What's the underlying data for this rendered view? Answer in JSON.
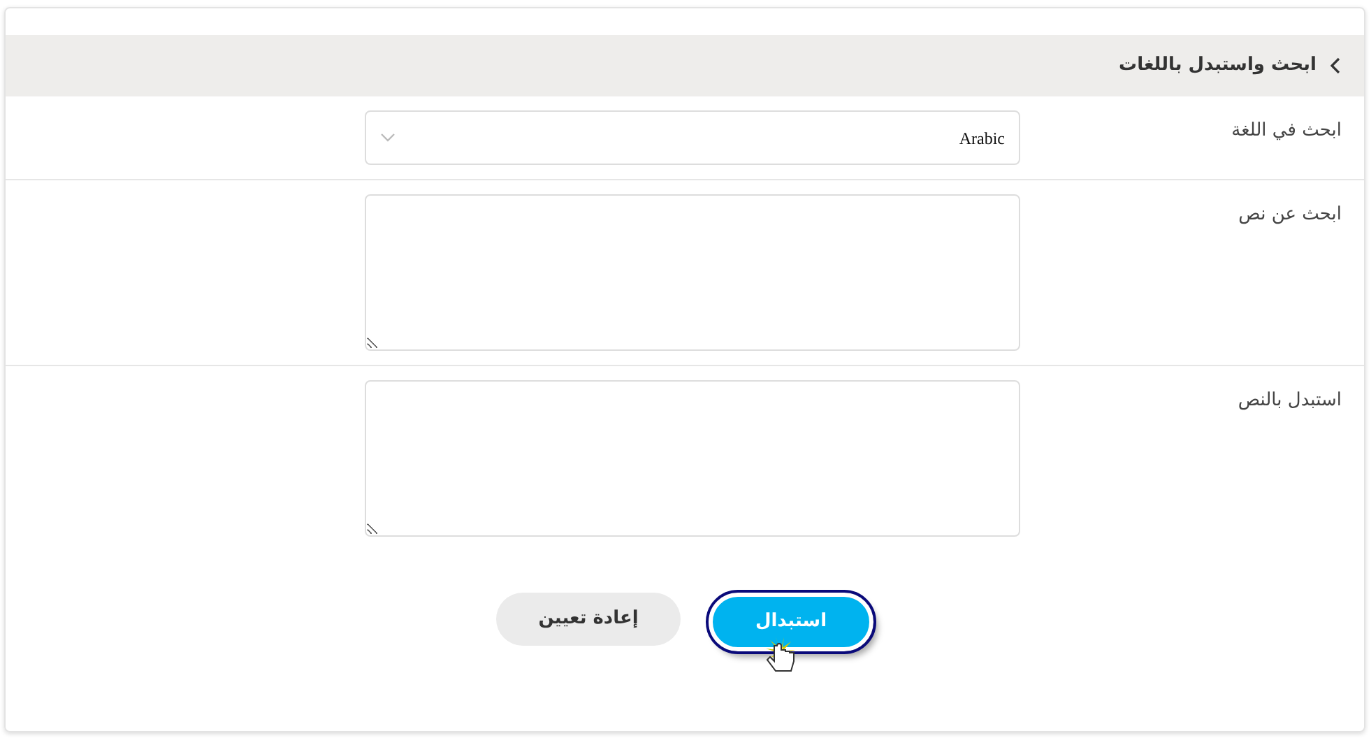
{
  "panel": {
    "title": "ابحث واستبدل باللغات",
    "expanded": true
  },
  "fields": [
    {
      "kind": "select",
      "label": "ابحث في اللغة",
      "value": "Arabic"
    },
    {
      "kind": "textarea",
      "label": "ابحث عن نص"
    },
    {
      "kind": "textarea",
      "label": "استبدل بالنص"
    }
  ],
  "buttons": [
    {
      "kind": "primary",
      "label": "استبدال",
      "focused": true
    },
    {
      "kind": "secondary",
      "label": "إعادة تعيين",
      "focused": false
    }
  ]
}
